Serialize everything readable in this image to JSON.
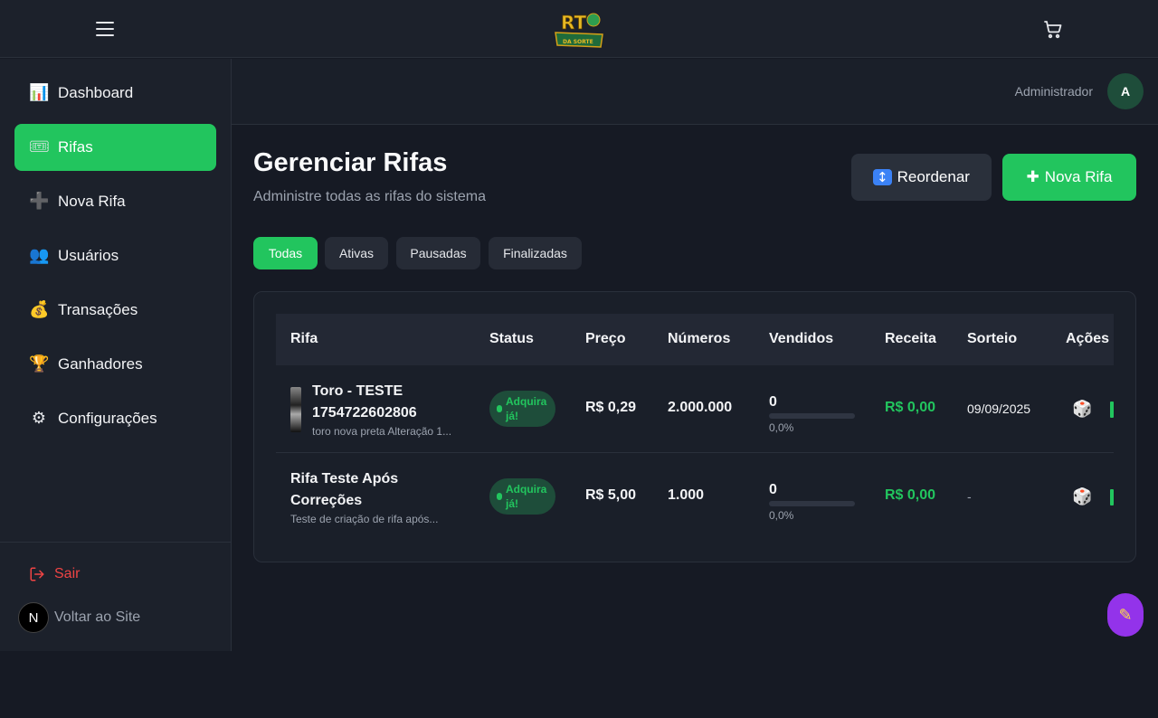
{
  "header": {
    "menu_icon": "hamburger-icon",
    "logo_text": "RT",
    "logo_subtext": "DA SORTE",
    "cart_icon": "cart-icon"
  },
  "sidebar": {
    "items": [
      {
        "label": "Dashboard",
        "icon": "📊"
      },
      {
        "label": "Rifas",
        "icon": "🎟"
      },
      {
        "label": "Nova Rifa",
        "icon": "➕"
      },
      {
        "label": "Usuários",
        "icon": "👥"
      },
      {
        "label": "Transações",
        "icon": "💰"
      },
      {
        "label": "Ganhadores",
        "icon": "🏆"
      },
      {
        "label": "Configurações",
        "icon": "⚙"
      }
    ],
    "active": "Rifas",
    "logout_label": "Sair",
    "back_badge": "N",
    "back_label": "Voltar ao Site"
  },
  "userbar": {
    "name": "Administrador",
    "avatar_initial": "A"
  },
  "page": {
    "title": "Gerenciar Rifas",
    "subtitle": "Administre todas as rifas do sistema",
    "reorder_icon": "↕",
    "reorder_label": "Reordenar",
    "new_icon": "✚",
    "new_label": "Nova Rifa"
  },
  "filters": [
    "Todas",
    "Ativas",
    "Pausadas",
    "Finalizadas"
  ],
  "active_filter": "Todas",
  "table": {
    "columns": [
      "Rifa",
      "Status",
      "Preço",
      "Números",
      "Vendidos",
      "Receita",
      "Sorteio",
      "Ações"
    ],
    "rows": [
      {
        "title_line1": "Toro - TESTE",
        "title_line2": "1754722602806",
        "description": "toro nova preta Alteração 1...",
        "status_line1": "Adquira",
        "status_line2": "já!",
        "price": "R$ 0,29",
        "numbers": "2.000.000",
        "sold": "0",
        "sold_fraction": 0,
        "sold_pct": "0,0%",
        "revenue": "R$ 0,00",
        "draw_date": "09/09/2025",
        "dice_icon": "🎲"
      },
      {
        "title_line1": "Rifa Teste Após",
        "title_line2": "Correções",
        "description": "Teste de criação de rifa após...",
        "status_line1": "Adquira",
        "status_line2": "já!",
        "price": "R$ 5,00",
        "numbers": "1.000",
        "sold": "0",
        "sold_fraction": 0,
        "sold_pct": "0,0%",
        "revenue": "R$ 0,00",
        "draw_date": "-",
        "dice_icon": "🎲"
      }
    ]
  },
  "fab_icon": "✎",
  "colors": {
    "accent": "#22c55e",
    "background": "#161a24",
    "panel": "#1c212b",
    "danger": "#ef4444",
    "fab": "#9333ea"
  }
}
